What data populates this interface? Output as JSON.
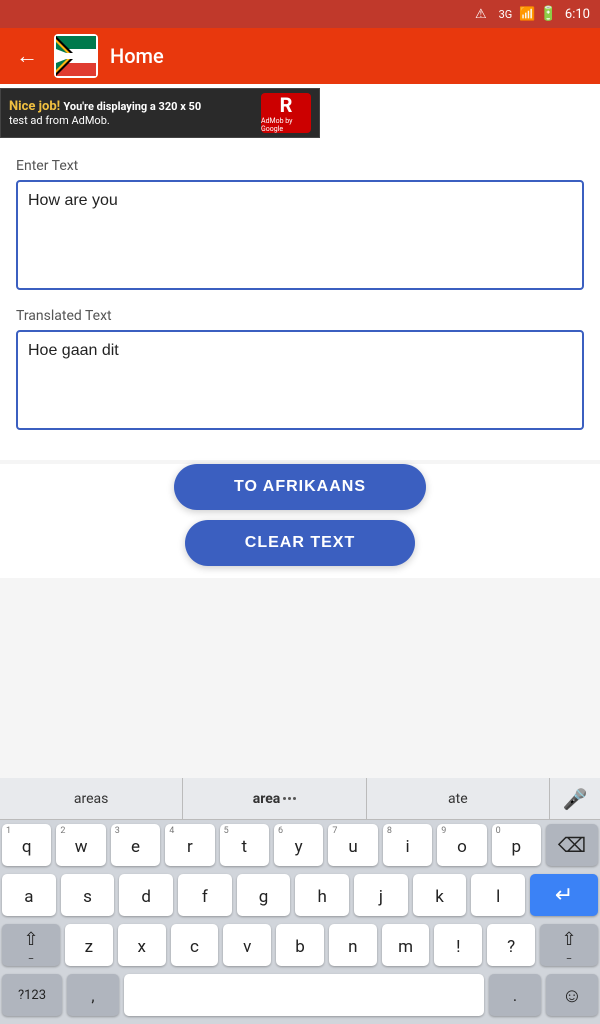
{
  "statusBar": {
    "network": "3G",
    "time": "6:10"
  },
  "topBar": {
    "backLabel": "←",
    "title": "Home"
  },
  "adBanner": {
    "niceLine": "Nice job!",
    "descLine": "You're displaying a 320 x 50\ntest ad from AdMob.",
    "logoText": "R",
    "logoSub": "AdMob by Google"
  },
  "enterTextLabel": "Enter Text",
  "inputText": "How are you",
  "translatedTextLabel": "Translated Text",
  "translatedText": "Hoe gaan dit",
  "buttons": {
    "translate": "TO AFRIKAANS",
    "clear": "CLEAR TEXT"
  },
  "keyboard": {
    "suggestions": [
      "areas",
      "area",
      "ate"
    ],
    "rows": [
      [
        {
          "num": "1",
          "letter": "q"
        },
        {
          "num": "2",
          "letter": "w"
        },
        {
          "num": "3",
          "letter": "e"
        },
        {
          "num": "4",
          "letter": "r"
        },
        {
          "num": "5",
          "letter": "t"
        },
        {
          "num": "6",
          "letter": "y"
        },
        {
          "num": "7",
          "letter": "u"
        },
        {
          "num": "8",
          "letter": "i"
        },
        {
          "num": "9",
          "letter": "o"
        },
        {
          "num": "0",
          "letter": "p"
        }
      ],
      [
        {
          "num": "",
          "letter": "a"
        },
        {
          "num": "",
          "letter": "s"
        },
        {
          "num": "",
          "letter": "d"
        },
        {
          "num": "",
          "letter": "f"
        },
        {
          "num": "",
          "letter": "g"
        },
        {
          "num": "",
          "letter": "h"
        },
        {
          "num": "",
          "letter": "j"
        },
        {
          "num": "",
          "letter": "k"
        },
        {
          "num": "",
          "letter": "l"
        }
      ],
      [
        {
          "num": "",
          "letter": "z"
        },
        {
          "num": "",
          "letter": "x"
        },
        {
          "num": "",
          "letter": "c"
        },
        {
          "num": "",
          "letter": "v"
        },
        {
          "num": "",
          "letter": "b"
        },
        {
          "num": "",
          "letter": "n"
        },
        {
          "num": "",
          "letter": "m"
        }
      ]
    ],
    "bottomRow": {
      "numSym": "?123",
      "comma": ",",
      "dot": ".",
      "emoji": "☺"
    }
  }
}
